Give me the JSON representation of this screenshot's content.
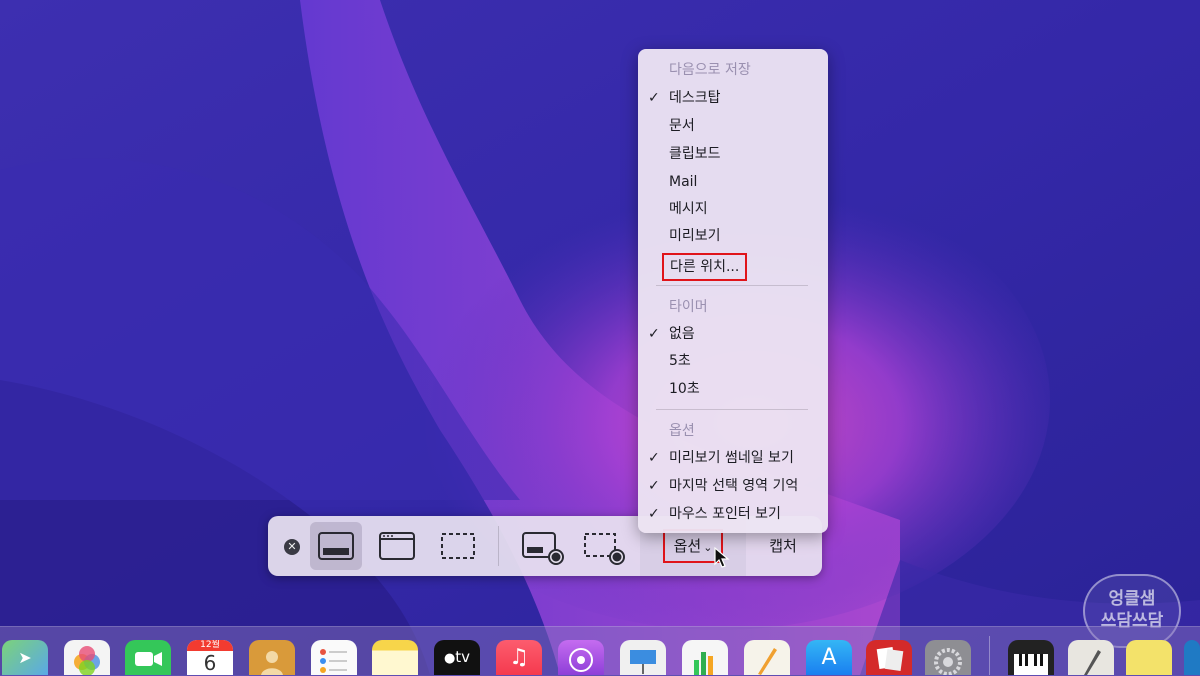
{
  "toolbar": {
    "modes": [
      {
        "name": "capture-entire-screen",
        "selected": true
      },
      {
        "name": "capture-selected-window",
        "selected": false
      },
      {
        "name": "capture-selected-portion",
        "selected": false
      },
      {
        "name": "record-entire-screen",
        "selected": false
      },
      {
        "name": "record-selected-portion",
        "selected": false
      }
    ],
    "options_label": "옵션",
    "capture_label": "캡처"
  },
  "menu": {
    "save_header": "다음으로 저장",
    "save_items": [
      {
        "label": "데스크탑",
        "checked": true
      },
      {
        "label": "문서",
        "checked": false
      },
      {
        "label": "클립보드",
        "checked": false
      },
      {
        "label": "Mail",
        "checked": false
      },
      {
        "label": "메시지",
        "checked": false
      },
      {
        "label": "미리보기",
        "checked": false
      },
      {
        "label": "다른 위치...",
        "checked": false
      }
    ],
    "timer_header": "타이머",
    "timer_items": [
      {
        "label": "없음",
        "checked": true
      },
      {
        "label": "5초",
        "checked": false
      },
      {
        "label": "10초",
        "checked": false
      }
    ],
    "options_header": "옵션",
    "options_items": [
      {
        "label": "미리보기 썸네일 보기",
        "checked": true
      },
      {
        "label": "마지막 선택 영역 기억",
        "checked": true
      },
      {
        "label": "마우스 포인터 보기",
        "checked": true
      }
    ],
    "check_glyph": "✓"
  },
  "dock": {
    "calendar_month": "12월",
    "calendar_day": "6",
    "tv_label": "tv",
    "icons": [
      "maps-icon",
      "photos-icon",
      "facetime-icon",
      "calendar-icon",
      "contacts-icon",
      "reminders-icon",
      "notes-icon",
      "apple-tv-icon",
      "music-icon",
      "podcasts-icon",
      "keynote-icon",
      "numbers-icon",
      "pages-icon",
      "app-store-icon",
      "photo-booth-icon",
      "system-preferences-icon",
      "piano-icon",
      "script-editor-icon",
      "stickies-icon",
      "messages-icon"
    ]
  },
  "watermark": {
    "line1": "엉클샘",
    "line2": "쓰담쓰담"
  },
  "colors": {
    "highlight": "#e0141a",
    "menu_bg": "#ece4f2",
    "toolbar_bg": "#e8e2f0"
  }
}
